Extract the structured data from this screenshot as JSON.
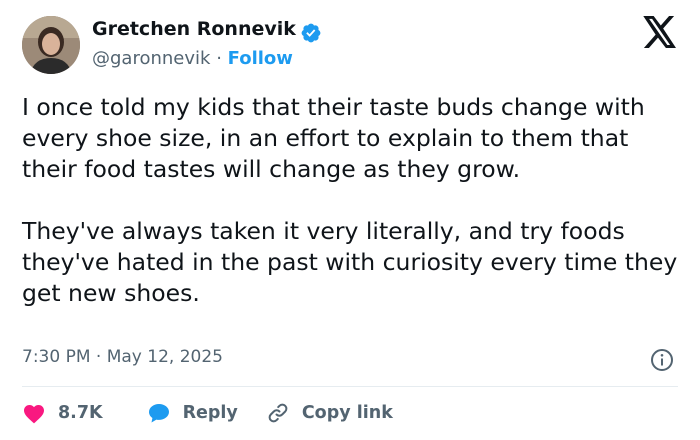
{
  "author": {
    "name": "Gretchen Ronnevik",
    "handle": "@garonnevik",
    "separator": "·",
    "follow_label": "Follow"
  },
  "tweet": {
    "paragraph_1": "I once told my kids that their taste buds change with every shoe size, in an effort to explain to them that their food tastes will change as they grow.",
    "paragraph_2": "They've always taken it very literally, and try foods they've hated in the past with curiosity every time they get new shoes."
  },
  "meta": {
    "time": "7:30 PM",
    "separator": "·",
    "date": "May 12, 2025"
  },
  "actions": {
    "likes_count": "8.7K",
    "reply_label": "Reply",
    "copy_link_label": "Copy link"
  },
  "icons": {
    "logo": "x-logo-icon",
    "verified": "verified-badge-icon",
    "info": "info-icon",
    "like": "heart-icon",
    "reply": "speech-bubble-icon",
    "copy": "link-icon"
  },
  "colors": {
    "accent": "#1d9bf0",
    "like": "#f91880",
    "text": "#0f1419",
    "muted": "#536471"
  }
}
